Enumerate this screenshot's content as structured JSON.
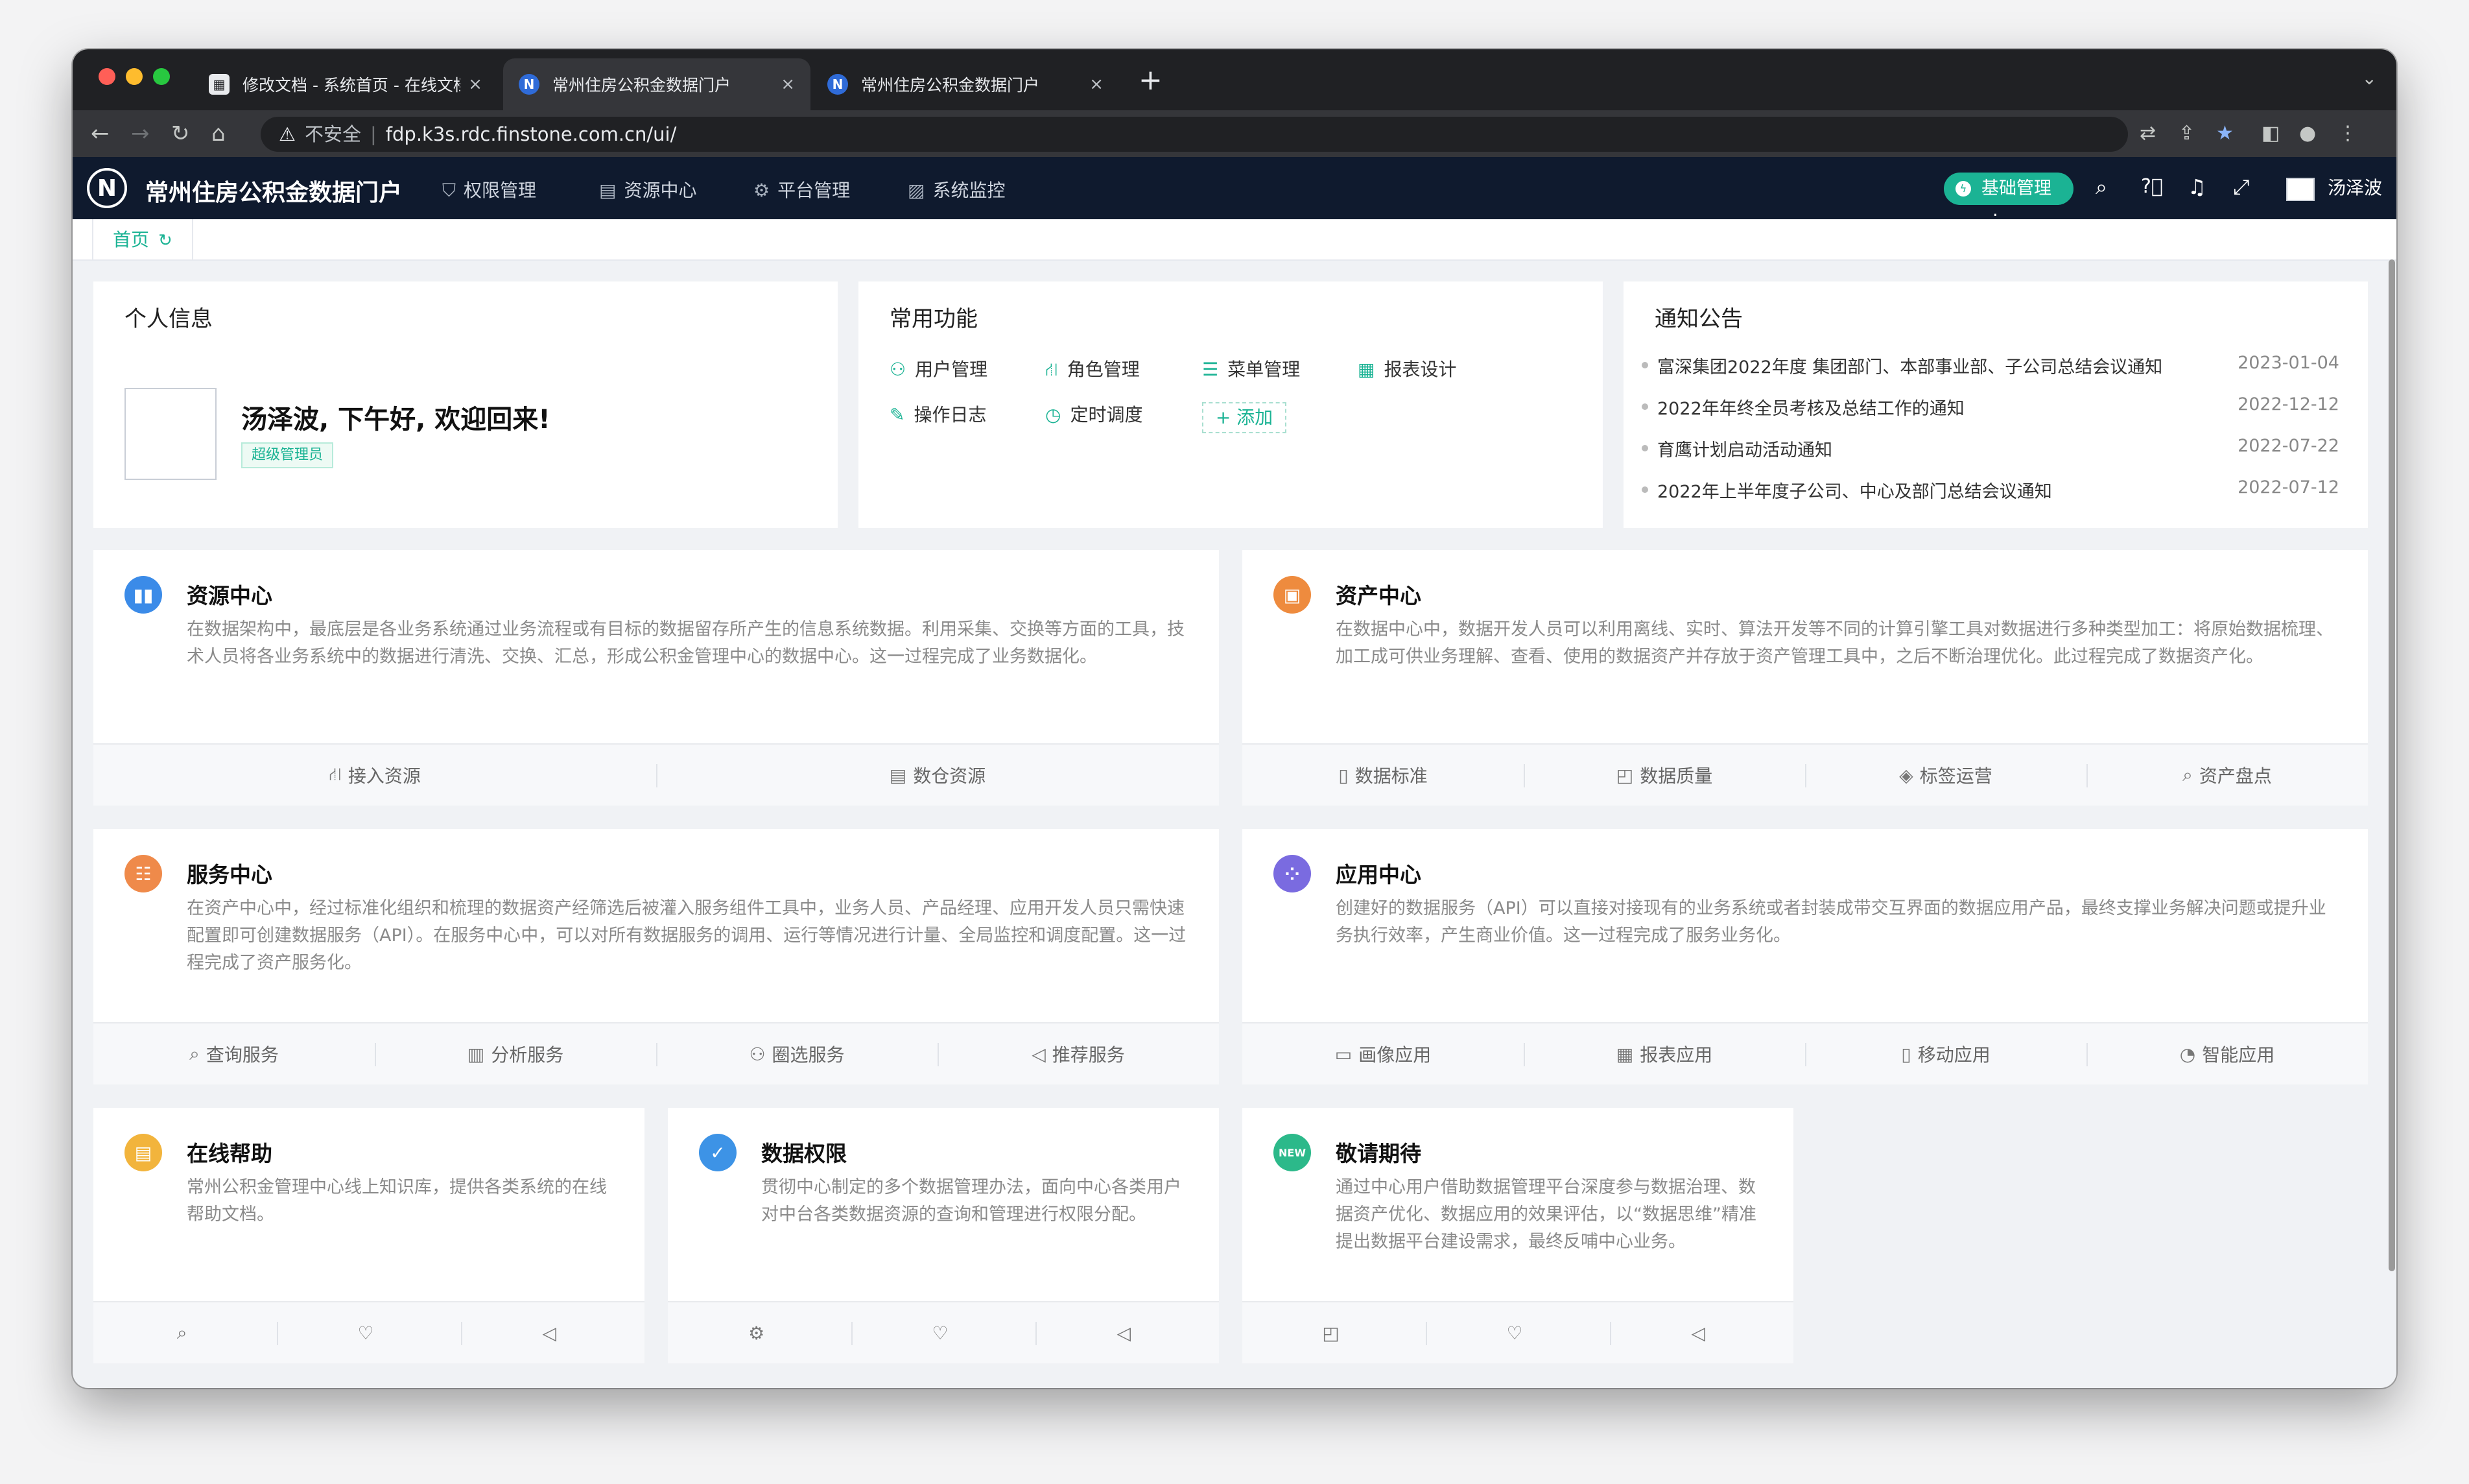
{
  "browser": {
    "tabs": [
      {
        "title": "修改文档 - 系统首页 - 在线文档·",
        "icon": "doc-icon"
      },
      {
        "title": "常州住房公积金数据门户",
        "icon": "N"
      },
      {
        "title": "常州住房公积金数据门户",
        "icon": "N"
      }
    ],
    "new_tab": "+",
    "close": "×",
    "security": "不安全",
    "url": "fdp.k3s.rdc.finstone.com.cn/ui/"
  },
  "app": {
    "logo": "N",
    "title": "常州住房公积金数据门户",
    "nav": [
      {
        "label": "权限管理",
        "icon": "shield-icon"
      },
      {
        "label": "资源中心",
        "icon": "doc-icon"
      },
      {
        "label": "平台管理",
        "icon": "gear-icon"
      },
      {
        "label": "系统监控",
        "icon": "monitor-icon"
      }
    ],
    "base_button": "基础管理",
    "user": "汤泽波"
  },
  "breadcrumb": {
    "home": "首页",
    "refresh_icon": "refresh-icon"
  },
  "profile": {
    "title": "个人信息",
    "greeting": "汤泽波, 下午好, 欢迎回来!",
    "role": "超级管理员"
  },
  "quick": {
    "title": "常用功能",
    "items": [
      {
        "label": "用户管理",
        "icon": "user-icon"
      },
      {
        "label": "角色管理",
        "icon": "role-icon"
      },
      {
        "label": "菜单管理",
        "icon": "menu-icon"
      },
      {
        "label": "报表设计",
        "icon": "table-icon"
      },
      {
        "label": "操作日志",
        "icon": "edit-icon"
      },
      {
        "label": "定时调度",
        "icon": "clock-icon"
      }
    ],
    "add": "+ 添加"
  },
  "notice": {
    "title": "通知公告",
    "items": [
      {
        "text": "富深集团2022年度 集团部门、本部事业部、子公司总结会议通知",
        "date": "2023-01-04"
      },
      {
        "text": "2022年年终全员考核及总结工作的通知",
        "date": "2022-12-12"
      },
      {
        "text": "育鹰计划启动活动通知",
        "date": "2022-07-22"
      },
      {
        "text": "2022年上半年度子公司、中心及部门总结会议通知",
        "date": "2022-07-12"
      }
    ]
  },
  "modules": [
    {
      "title": "资源中心",
      "color": "#3b8be8",
      "desc": "在数据架构中，最底层是各业务系统通过业务流程或有目标的数据留存所产生的信息系统数据。利用采集、交换等方面的工具，技术人员将各业务系统中的数据进行清洗、交换、汇总，形成公积金管理中心的数据中心。这一过程完成了业务数据化。",
      "actions": [
        {
          "label": "接入资源",
          "icon": "⛙"
        },
        {
          "label": "数仓资源",
          "icon": "▤"
        }
      ]
    },
    {
      "title": "资产中心",
      "color": "#ee8b3e",
      "desc": "在数据中心中，数据开发人员可以利用离线、实时、算法开发等不同的计算引擎工具对数据进行多种类型加工：将原始数据梳理、加工成可供业务理解、查看、使用的数据资产并存放于资产管理工具中，之后不断治理优化。此过程完成了数据资产化。",
      "actions": [
        {
          "label": "数据标准",
          "icon": "▯"
        },
        {
          "label": "数据质量",
          "icon": "◰"
        },
        {
          "label": "标签运营",
          "icon": "◈"
        },
        {
          "label": "资产盘点",
          "icon": "⌕"
        }
      ]
    },
    {
      "title": "服务中心",
      "color": "#ef8a4a",
      "desc": "在资产中心中，经过标准化组织和梳理的数据资产经筛选后被灌入服务组件工具中，业务人员、产品经理、应用开发人员只需快速配置即可创建数据服务（API）。在服务中心中，可以对所有数据服务的调用、运行等情况进行计量、全局监控和调度配置。这一过程完成了资产服务化。",
      "actions": [
        {
          "label": "查询服务",
          "icon": "⌕"
        },
        {
          "label": "分析服务",
          "icon": "▥"
        },
        {
          "label": "圈选服务",
          "icon": "⚇"
        },
        {
          "label": "推荐服务",
          "icon": "◁"
        }
      ]
    },
    {
      "title": "应用中心",
      "color": "#7a6be0",
      "desc": "创建好的数据服务（API）可以直接对接现有的业务系统或者封装成带交互界面的数据应用产品，最终支撑业务解决问题或提升业务执行效率，产生商业价值。这一过程完成了服务业务化。",
      "actions": [
        {
          "label": "画像应用",
          "icon": "▭"
        },
        {
          "label": "报表应用",
          "icon": "▦"
        },
        {
          "label": "移动应用",
          "icon": "▯"
        },
        {
          "label": "智能应用",
          "icon": "◔"
        }
      ]
    },
    {
      "title": "在线帮助",
      "color": "#f2b43c",
      "desc": "常州公积金管理中心线上知识库，提供各类系统的在线帮助文档。",
      "actions": [
        {
          "label": "",
          "icon": "⌕"
        },
        {
          "label": "",
          "icon": "♡"
        },
        {
          "label": "",
          "icon": "◁"
        }
      ]
    },
    {
      "title": "数据权限",
      "color": "#3d93e6",
      "desc": "贯彻中心制定的多个数据管理办法，面向中心各类用户对中台各类数据资源的查询和管理进行权限分配。",
      "actions": [
        {
          "label": "",
          "icon": "⚙"
        },
        {
          "label": "",
          "icon": "♡"
        },
        {
          "label": "",
          "icon": "◁"
        }
      ]
    },
    {
      "title": "敬请期待",
      "color": "#2cb98a",
      "desc": "通过中心用户借助数据管理平台深度参与数据治理、数据资产优化、数据应用的效果评估，以“数据思维”精准提出数据平台建设需求，最终反哺中心业务。",
      "actions": [
        {
          "label": "",
          "icon": "◰"
        },
        {
          "label": "",
          "icon": "♡"
        },
        {
          "label": "",
          "icon": "◁"
        }
      ]
    }
  ]
}
